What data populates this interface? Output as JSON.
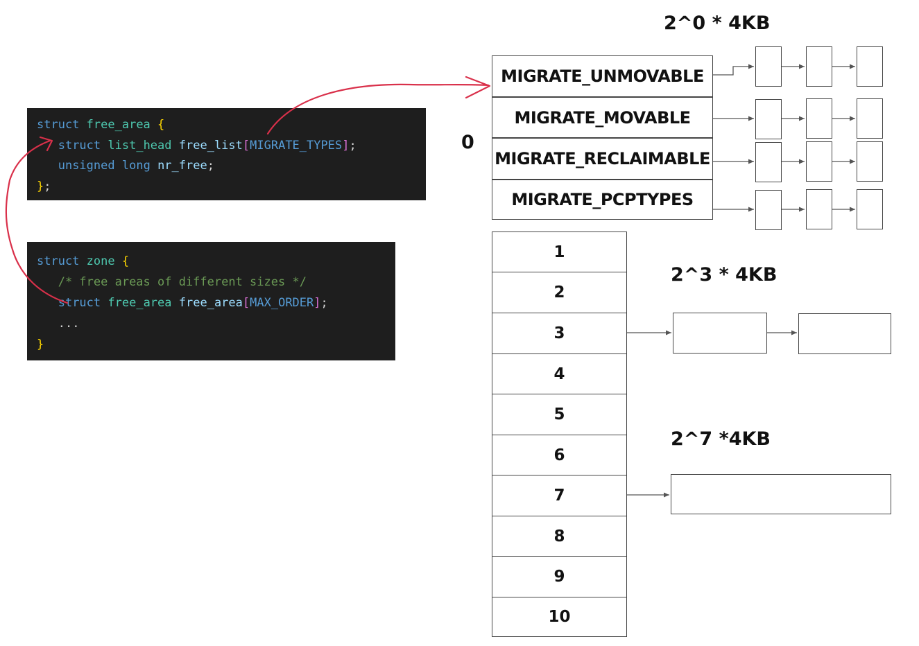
{
  "code_free_area": {
    "line1": {
      "kw": "struct",
      "type": "free_area",
      "brace": "{"
    },
    "line2": {
      "kw": "struct",
      "type": "list_head",
      "field": "free_list",
      "lb": "[",
      "macro": "MIGRATE_TYPES",
      "rb": "]",
      "end": ";"
    },
    "line3": {
      "kw1": "unsigned",
      "kw2": "long",
      "field": "nr_free",
      "end": ";"
    },
    "line4": {
      "brace": "}",
      "end": ";"
    }
  },
  "code_zone": {
    "line1": {
      "kw": "struct",
      "type": "zone",
      "brace": "{"
    },
    "line2": {
      "comment": "/* free areas of different sizes */"
    },
    "line3": {
      "kw": "struct",
      "type": "free_area",
      "field": "free_area",
      "lb": "[",
      "macro": "MAX_ORDER",
      "rb": "]",
      "end": ";"
    },
    "line4": {
      "ellipsis": "..."
    },
    "line5": {
      "brace": "}"
    }
  },
  "order_zero_label": "0",
  "size_labels": {
    "order0": "2^0 * 4KB",
    "order3": "2^3 * 4KB",
    "order7": "2^7 *4KB"
  },
  "migrate_types": [
    "MIGRATE_UNMOVABLE",
    "MIGRATE_MOVABLE",
    "MIGRATE_RECLAIMABLE",
    "MIGRATE_PCPTYPES"
  ],
  "orders": [
    "1",
    "2",
    "3",
    "4",
    "5",
    "6",
    "7",
    "8",
    "9",
    "10"
  ],
  "colors": {
    "code_bg": "#1e1e1e",
    "annotation_arrow": "#d9304a",
    "box_border": "#444444"
  }
}
